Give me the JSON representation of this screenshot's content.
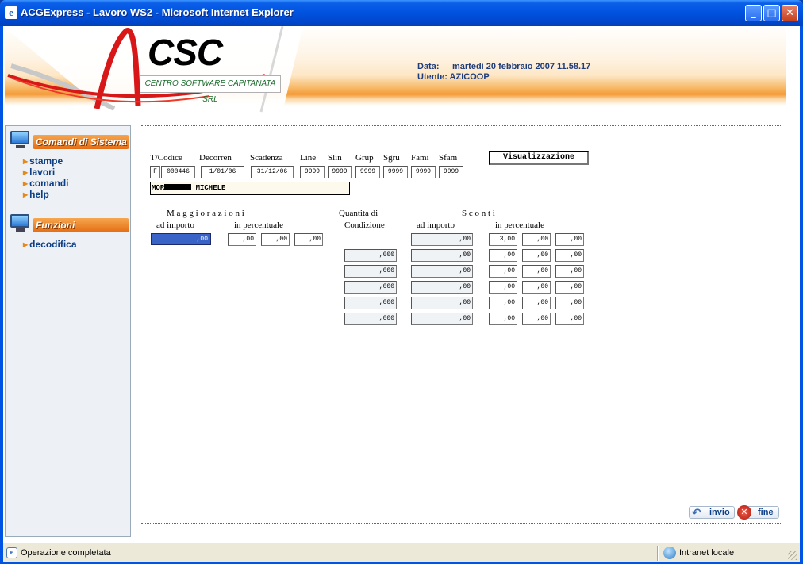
{
  "window": {
    "title": "ACGExpress - Lavoro WS2 - Microsoft Internet Explorer",
    "minimize": "_",
    "maximize": "□",
    "close": "✕"
  },
  "header": {
    "logo_text": "CSC",
    "company": "CENTRO SOFTWARE CAPITANATA SRL",
    "data_label": "Data:",
    "data_value": "martedì 20 febbraio 2007 11.58.17",
    "utente_label": "Utente:",
    "utente_value": "AZICOOP"
  },
  "sidebar": {
    "section1": "Comandi di Sistema",
    "items1": [
      "stampe",
      "lavori",
      "comandi",
      "help"
    ],
    "section2": "Funzioni",
    "items2": [
      "decodifica"
    ]
  },
  "form": {
    "mode": "Visualizzazione",
    "labels": [
      "T/Codice",
      "Decorren",
      "Scadenza",
      "Line",
      "Slin",
      "Grup",
      "Sgru",
      "Fami",
      "Sfam"
    ],
    "t": "F",
    "codice": "000446",
    "decorren": "1/01/06",
    "scadenza": "31/12/06",
    "line": "9999",
    "slin": "9999",
    "grup": "9999",
    "sgru": "9999",
    "fami": "9999",
    "sfam": "9999",
    "name_prefix": "MOR",
    "name_suffix": "MICHELE",
    "maggiorazioni_title": "M a g g i o r a z i o n i",
    "ad_importo": "ad importo",
    "in_percentuale": "in percentuale",
    "quantita_title": "Quantita di",
    "condizione": "Condizione",
    "sconti_title": "S c o n t i",
    "magg_importo": ",00",
    "magg_perc": [
      ",00",
      ",00",
      ",00"
    ],
    "rows": [
      {
        "qta": "",
        "importo": ",00",
        "perc": [
          "3,00",
          ",00",
          ",00"
        ]
      },
      {
        "qta": ",000",
        "importo": ",00",
        "perc": [
          ",00",
          ",00",
          ",00"
        ]
      },
      {
        "qta": ",000",
        "importo": ",00",
        "perc": [
          ",00",
          ",00",
          ",00"
        ]
      },
      {
        "qta": ",000",
        "importo": ",00",
        "perc": [
          ",00",
          ",00",
          ",00"
        ]
      },
      {
        "qta": ",000",
        "importo": ",00",
        "perc": [
          ",00",
          ",00",
          ",00"
        ]
      },
      {
        "qta": ",000",
        "importo": ",00",
        "perc": [
          ",00",
          ",00",
          ",00"
        ]
      }
    ]
  },
  "actions": {
    "invio": "invio",
    "fine": "fine"
  },
  "statusbar": {
    "text": "Operazione completata",
    "zone": "Intranet locale"
  }
}
